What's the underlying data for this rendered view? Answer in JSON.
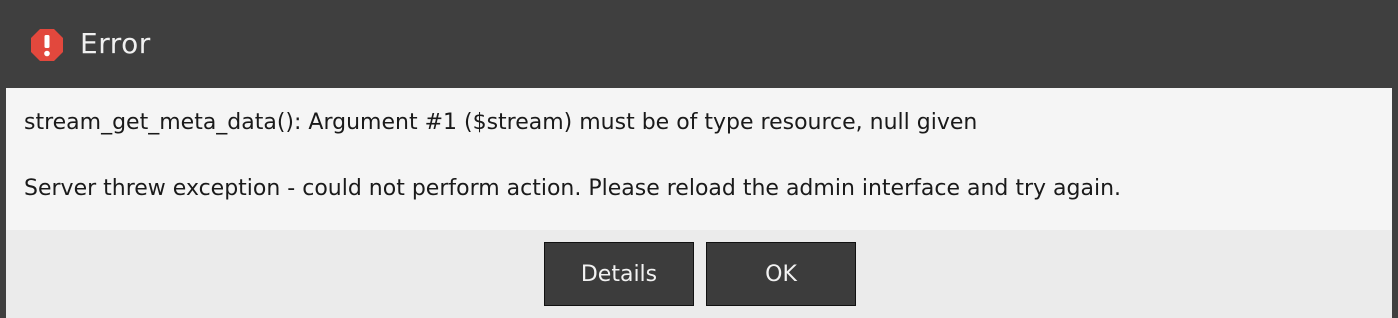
{
  "dialog": {
    "title": "Error",
    "icon": "error-exclamation-icon",
    "accent_color": "#e2483d",
    "message_line1": "stream_get_meta_data(): Argument #1 ($stream) must be of type resource, null given",
    "message_line2": "Server threw exception - could not perform action. Please reload the admin interface and try again."
  },
  "buttons": {
    "details_label": "Details",
    "ok_label": "OK"
  }
}
